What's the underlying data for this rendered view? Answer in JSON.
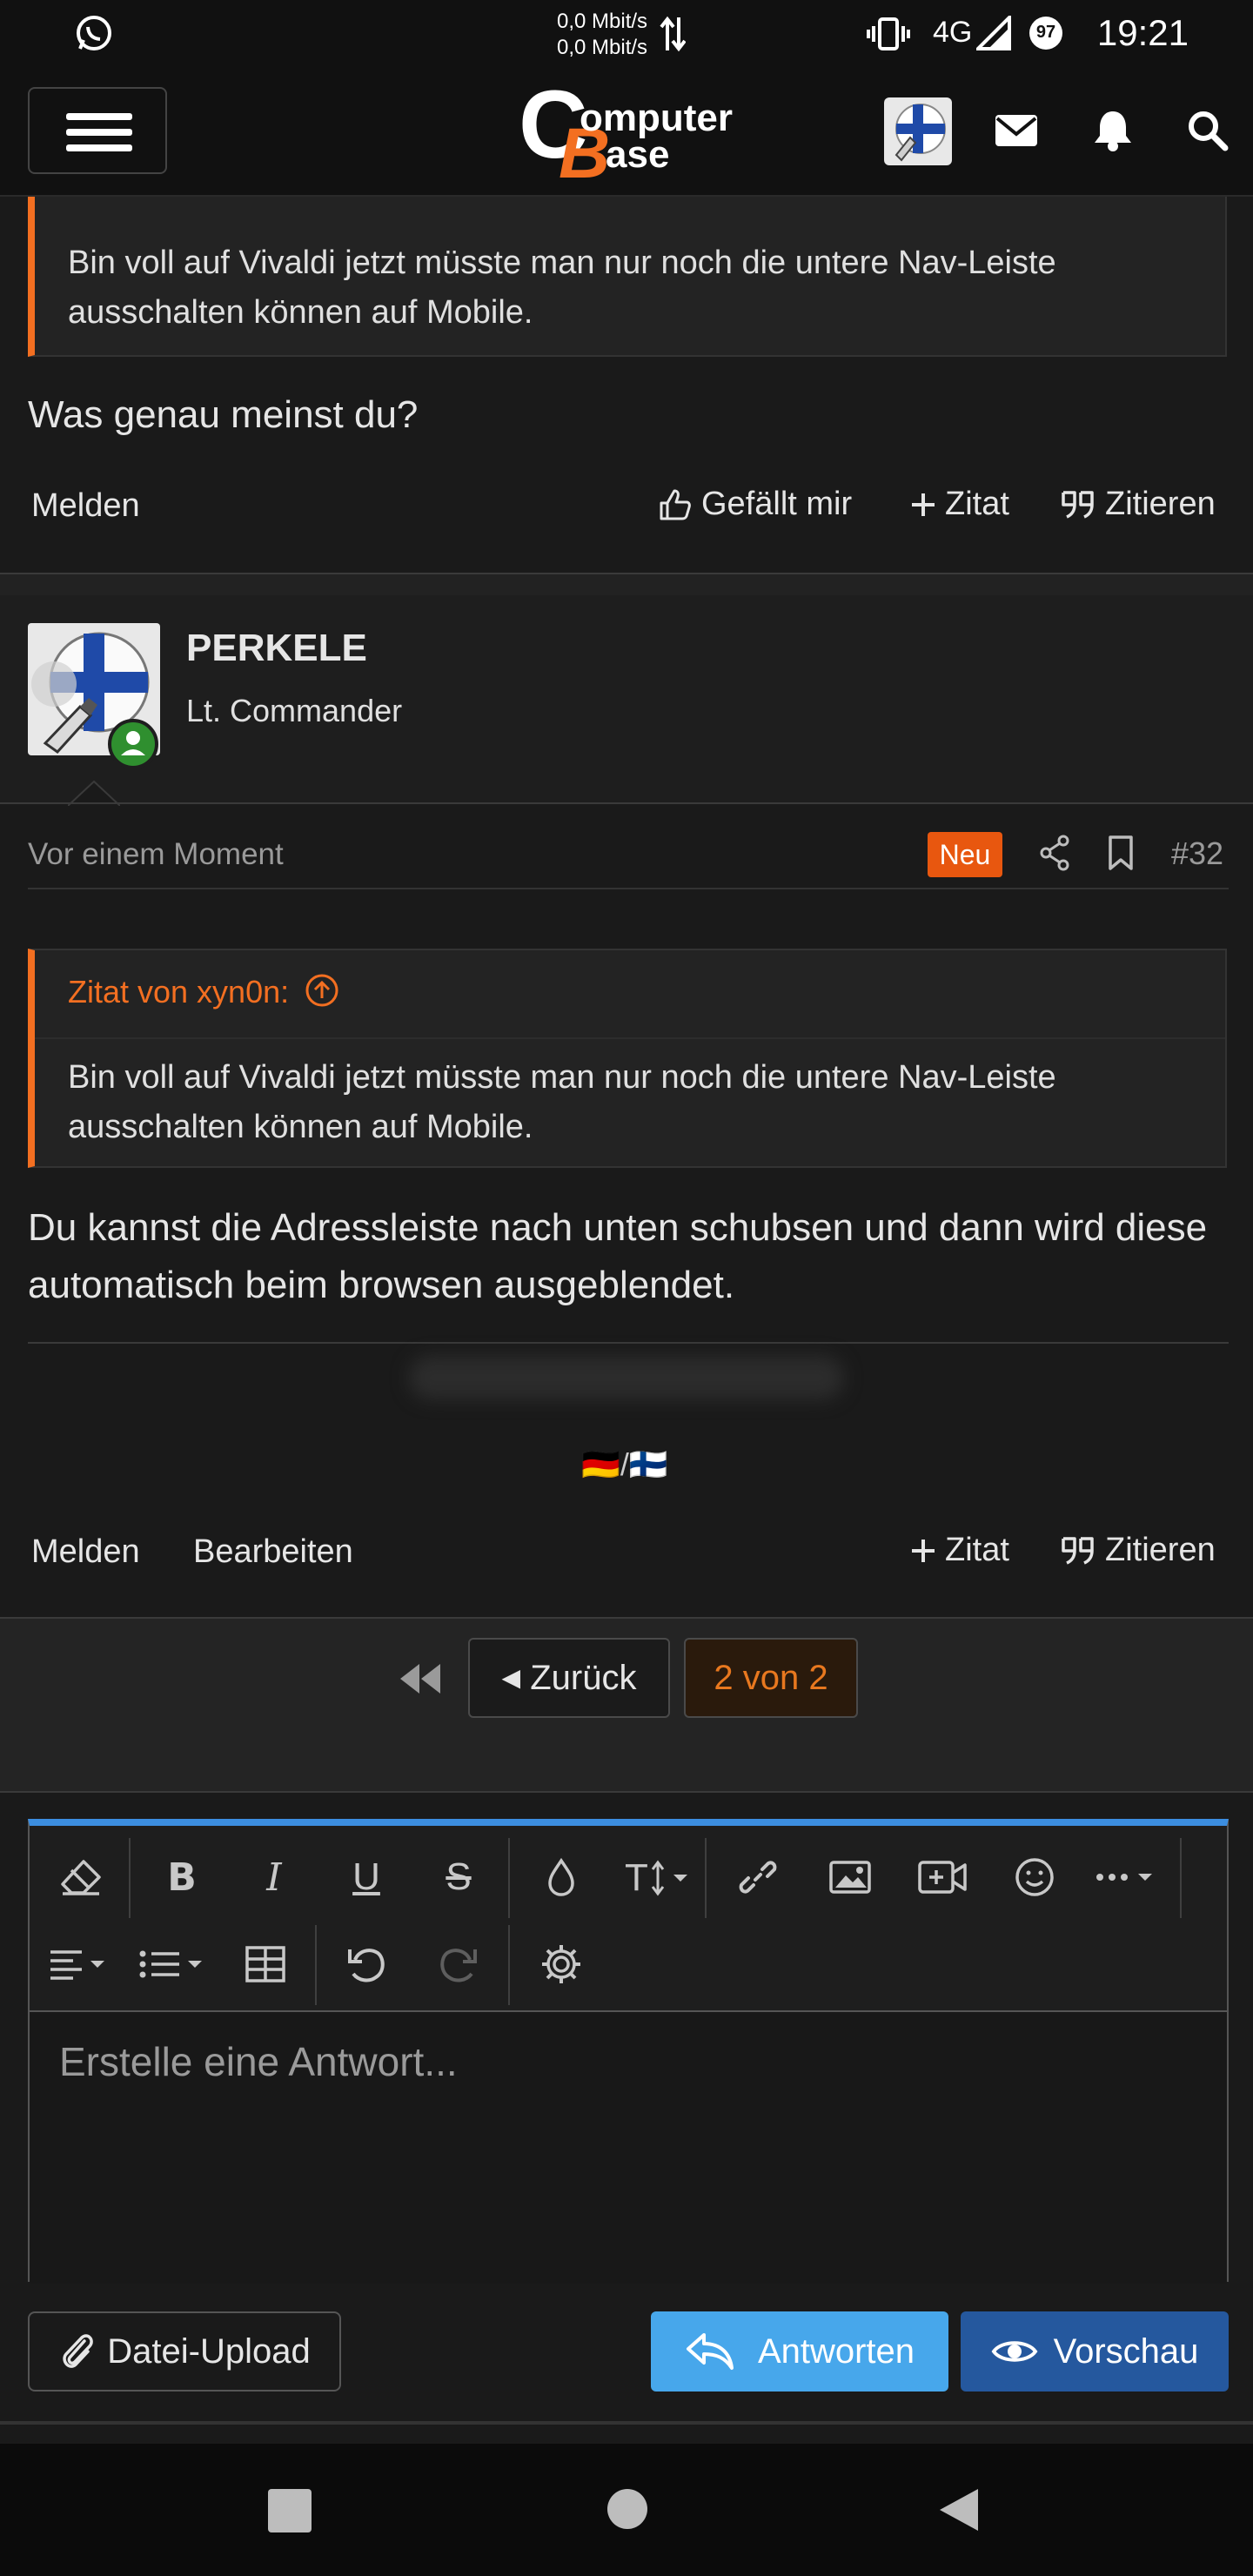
{
  "status_bar": {
    "time": "19:21",
    "network_up": "0,0 Mbit/s",
    "network_down": "0,0 Mbit/s",
    "signal": "4G",
    "battery": "97"
  },
  "header": {
    "logo_c": "C",
    "logo_b": "B",
    "logo_line1": "omputer",
    "logo_line2": "ase"
  },
  "prev_post": {
    "quote_body": "Bin voll auf Vivaldi jetzt müsste man nur noch die untere Nav-Leiste ausschalten können auf Mobile.",
    "text": "Was genau meinst du?",
    "actions": {
      "report": "Melden",
      "like": "Gefällt mir",
      "plus_quote": "Zitat",
      "quote": "Zitieren"
    }
  },
  "post": {
    "username": "PERKELE",
    "user_title": "Lt. Commander",
    "time": "Vor einem Moment",
    "badge": "Neu",
    "number": "#32",
    "quote_title": "Zitat von xyn0n:",
    "quote_body": "Bin voll auf Vivaldi jetzt müsste man nur noch die untere Nav-Leiste ausschalten können auf Mobile.",
    "text": "Du kannst die Adressleiste nach unten schubsen und dann wird diese automatisch beim browsen ausgeblendet.",
    "signature": "🇩🇪/🇫🇮",
    "actions": {
      "report": "Melden",
      "edit": "Bearbeiten",
      "plus_quote": "Zitat",
      "quote": "Zitieren"
    }
  },
  "pager": {
    "back": "Zurück",
    "current": "2 von 2"
  },
  "editor": {
    "placeholder": "Erstelle eine Antwort...",
    "upload": "Datei-Upload",
    "reply": "Antworten",
    "preview": "Vorschau"
  },
  "colors": {
    "accent": "#f36f21",
    "reply_button": "#47a7eb",
    "preview_button": "#25589e",
    "editor_top": "#3c8ee0"
  }
}
